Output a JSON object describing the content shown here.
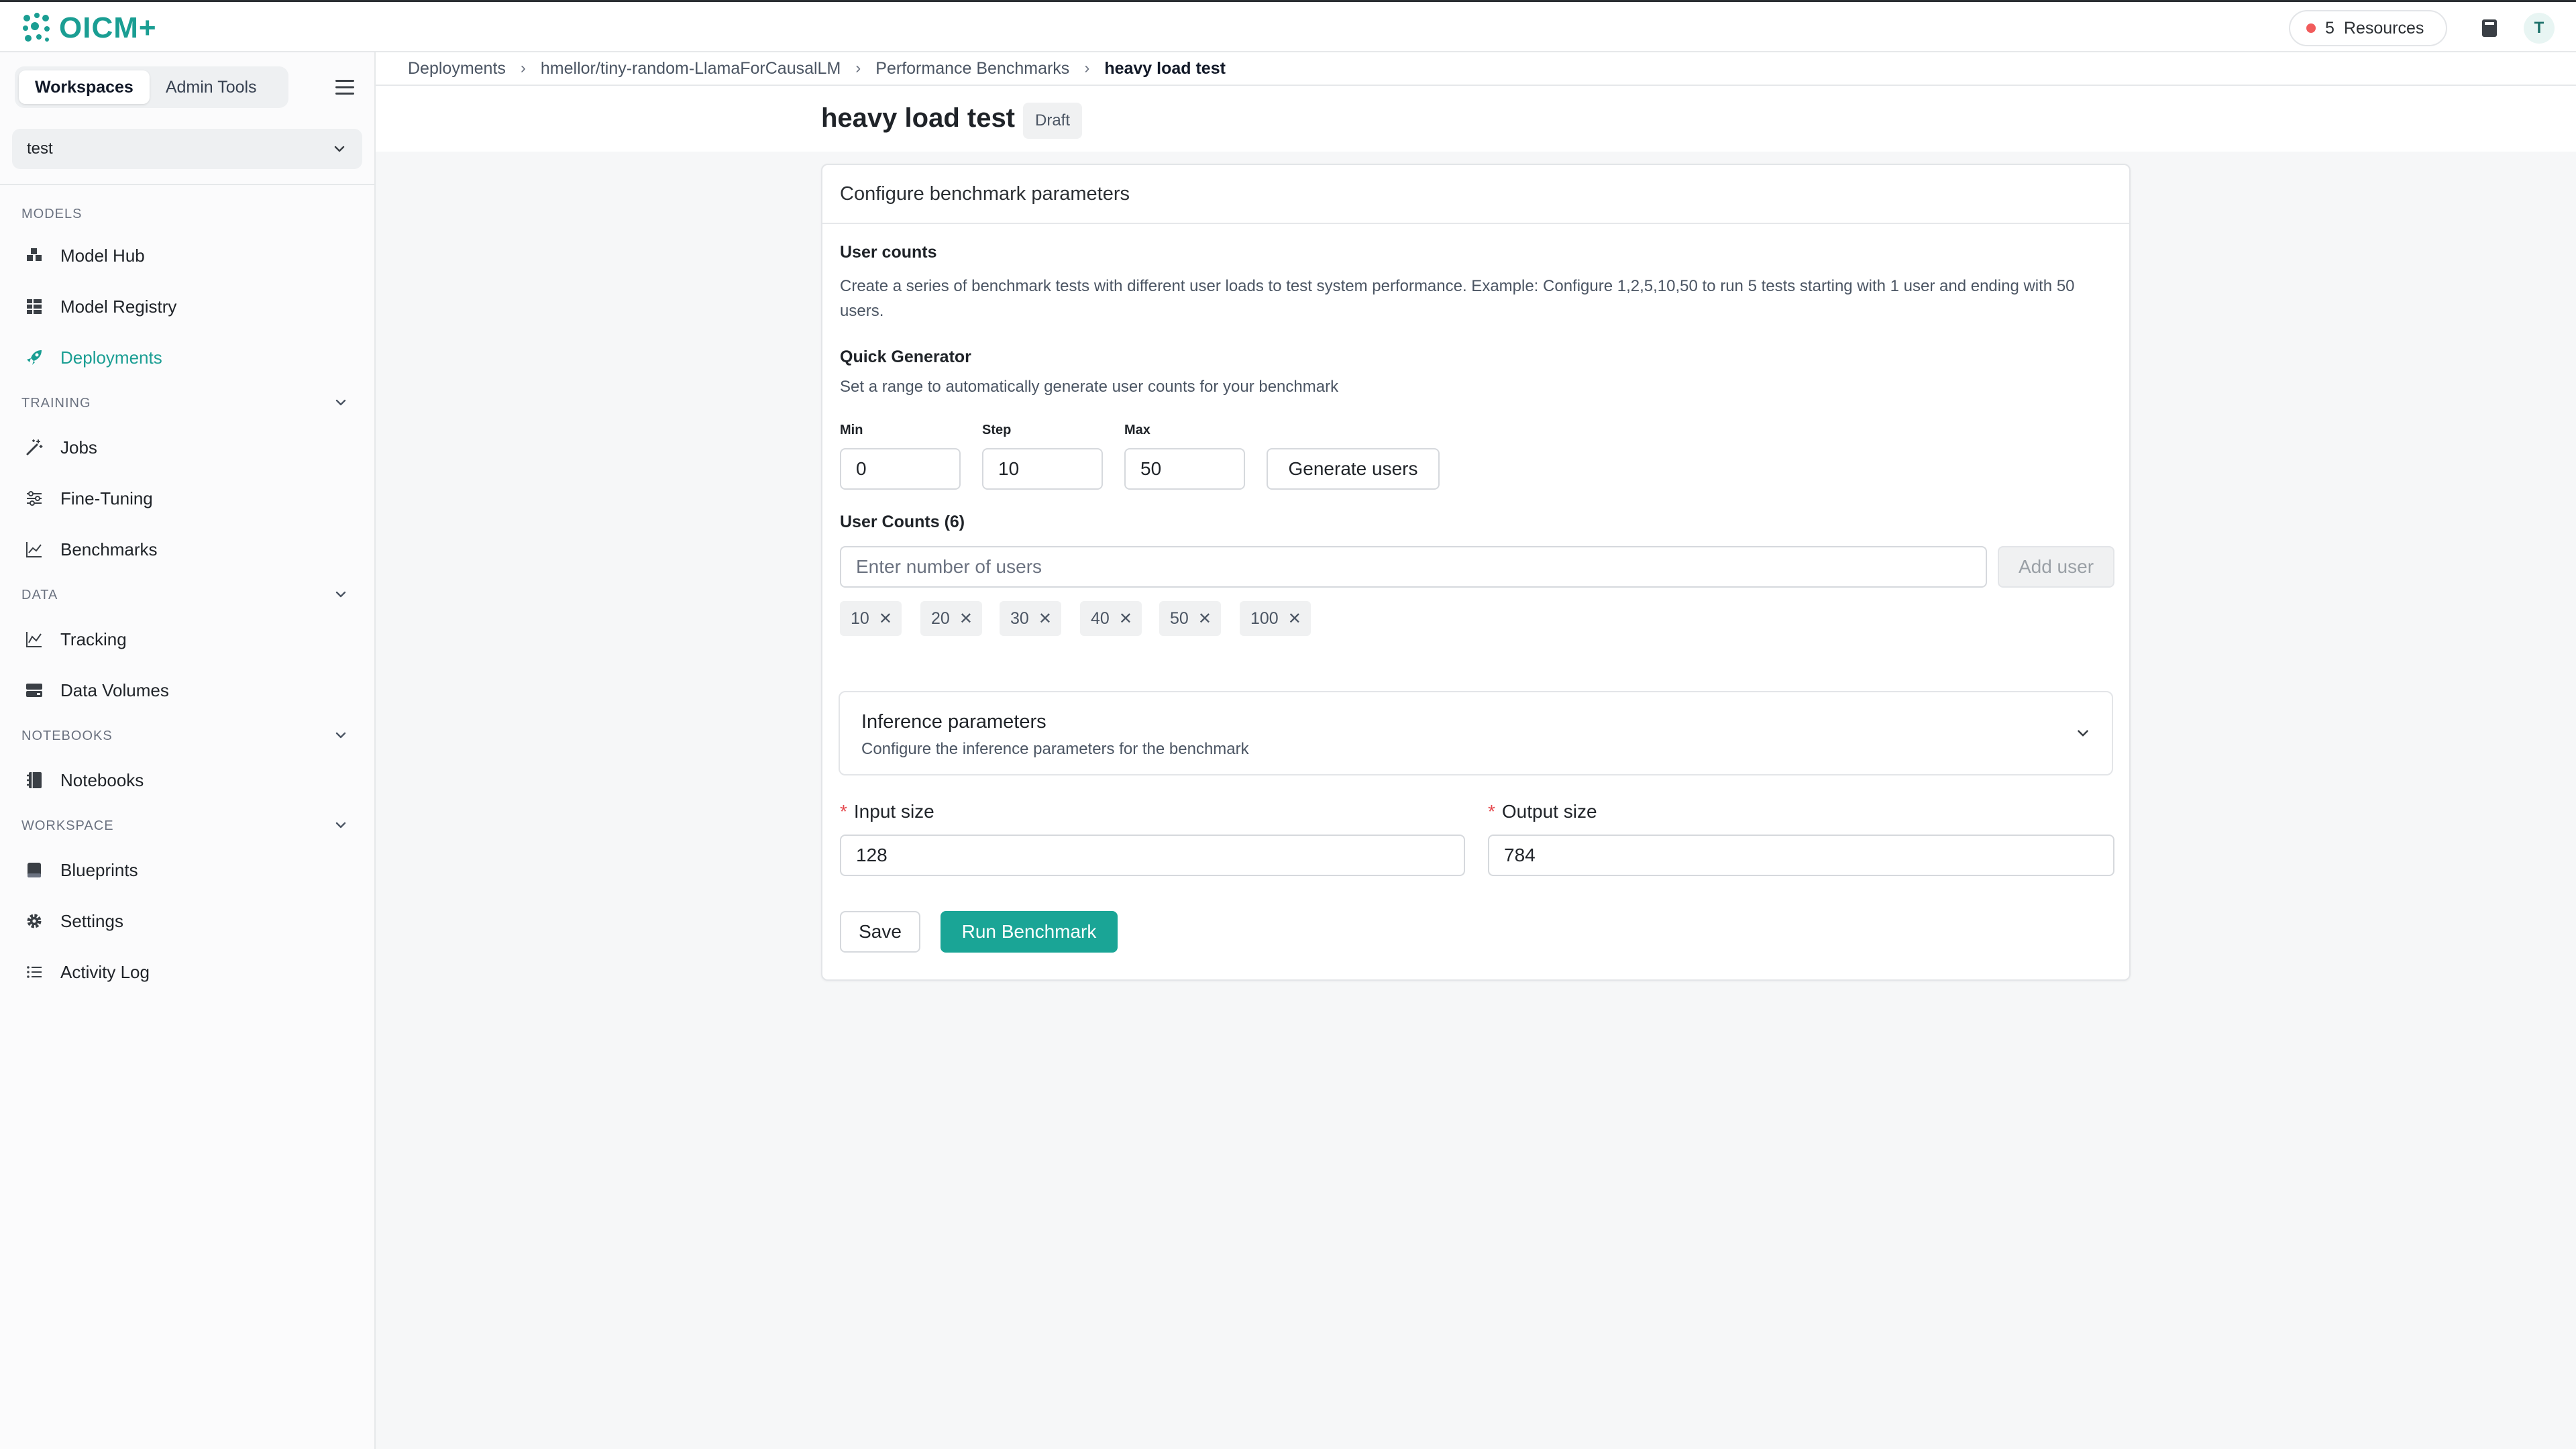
{
  "app": {
    "logo_text": "OICM+",
    "resources_count": "5",
    "resources_label": "Resources",
    "avatar_initial": "T",
    "accent_color": "#1aa596"
  },
  "sidebar": {
    "tabs": [
      "Workspaces",
      "Admin Tools"
    ],
    "active_tab": "Workspaces",
    "workspace": "test",
    "sections": {
      "models": "MODELS",
      "training": "TRAINING",
      "data": "DATA",
      "notebooks": "NOTEBOOKS",
      "workspace": "WORKSPACE"
    },
    "items": {
      "model_hub": "Model Hub",
      "model_registry": "Model Registry",
      "deployments": "Deployments",
      "jobs": "Jobs",
      "fine_tuning": "Fine-Tuning",
      "benchmarks": "Benchmarks",
      "tracking": "Tracking",
      "data_volumes": "Data Volumes",
      "notebooks": "Notebooks",
      "blueprints": "Blueprints",
      "settings": "Settings",
      "activity_log": "Activity Log"
    },
    "active_item": "Deployments"
  },
  "breadcrumb": [
    "Deployments",
    "hmellor/tiny-random-LlamaForCausalLM",
    "Performance Benchmarks",
    "heavy load test"
  ],
  "page": {
    "title": "heavy load test",
    "status_badge": "Draft"
  },
  "form": {
    "card_title": "Configure benchmark parameters",
    "user_counts_title": "User counts",
    "user_counts_description": "Create a series of benchmark tests with different user loads to test system performance. Example: Configure 1,2,5,10,50 to run 5 tests starting with 1 user and ending with 50 users.",
    "quick_generator_title": "Quick Generator",
    "quick_generator_description": "Set a range to automatically generate user counts for your benchmark",
    "min_label": "Min",
    "min_value": "0",
    "step_label": "Step",
    "step_value": "10",
    "max_label": "Max",
    "max_value": "50",
    "generate_button": "Generate users",
    "user_counts_list_label": "User Counts (6)",
    "user_input_placeholder": "Enter number of users",
    "add_user_button": "Add user",
    "user_counts": [
      "10",
      "20",
      "30",
      "40",
      "50",
      "100"
    ],
    "inference_title": "Inference parameters",
    "inference_description": "Configure the inference parameters for the benchmark",
    "input_size_label": "Input size",
    "input_size_value": "128",
    "output_size_label": "Output size",
    "output_size_value": "784",
    "save_button": "Save",
    "run_button": "Run Benchmark"
  }
}
